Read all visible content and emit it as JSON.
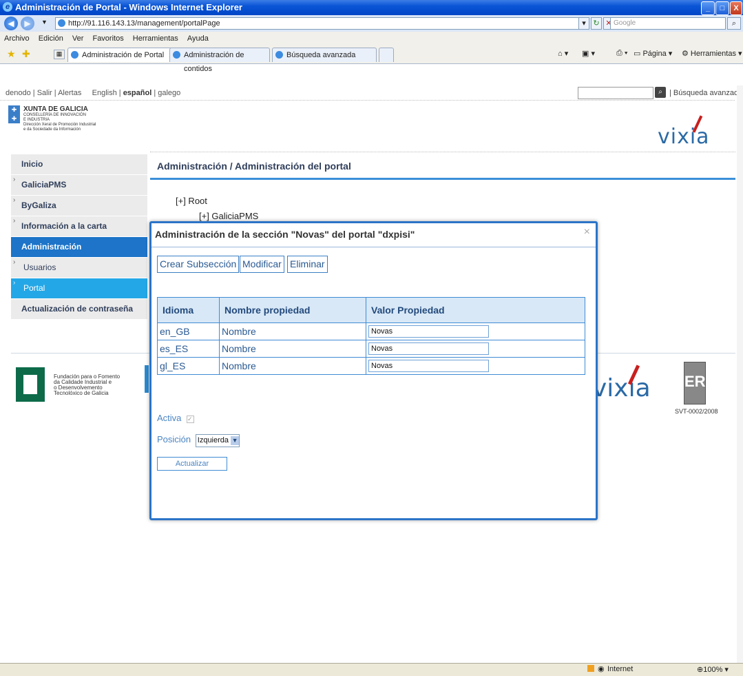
{
  "window": {
    "title": "Administración de Portal - Windows Internet Explorer",
    "controls": [
      "_",
      "□",
      "X"
    ]
  },
  "address": {
    "url": "http://91.116.143.13/management/portalPage",
    "search_placeholder": "Google"
  },
  "menu": [
    "Archivo",
    "Edición",
    "Ver",
    "Favoritos",
    "Herramientas",
    "Ayuda"
  ],
  "tabs": [
    "Administración de Portal",
    "Administración de contidos",
    "Búsqueda avanzada"
  ],
  "toolbar": {
    "page_label": "Página",
    "tools_label": "Herramientas"
  },
  "topbar": {
    "user": "denodo",
    "logout": "Salir",
    "alerts": "Alertas",
    "lang_en": "English",
    "lang_es": "español",
    "lang_gl": "galego",
    "advanced_search": "Búsqueda avanzada"
  },
  "header_logo": {
    "xunta": "XUNTA DE GALICIA",
    "line1": "CONSELLERÍA DE INNOVACIÓN",
    "line2": "E INDUSTRIA",
    "line3": "Dirección Xeral de Promoción Industrial",
    "line4": "e da Sociedade da Información",
    "brand": "vixia"
  },
  "sidebar": {
    "items": [
      {
        "label": "Inicio"
      },
      {
        "label": "GaliciaPMS"
      },
      {
        "label": "ByGaliza"
      },
      {
        "label": "Información a la carta"
      },
      {
        "label": "Administración"
      },
      {
        "label": "Usuarios"
      },
      {
        "label": "Portal"
      },
      {
        "label": "Actualización de contraseña"
      }
    ]
  },
  "main": {
    "title": "Administración / Administración del portal",
    "tree_root": "[+] Root",
    "tree_child": "[+] GaliciaPMS"
  },
  "footer": {
    "fund_line1": "Fundación para o Fomento",
    "fund_line2": "da Calidade Industrial e",
    "fund_line3": "o Desenvolvemento",
    "fund_line4": "Tecnolóxico de Galicia",
    "brand": "vixia",
    "er_letter": "ER",
    "cert": "SVT-0002/2008"
  },
  "modal": {
    "title": "Administración de la sección \"Novas\" del portal \"dxpisi\"",
    "close": "×",
    "buttons": {
      "create": "Crear Subsección",
      "modify": "Modificar",
      "delete": "Eliminar"
    },
    "table": {
      "headers": [
        "Idioma",
        "Nombre propiedad",
        "Valor Propiedad"
      ],
      "rows": [
        {
          "lang": "en_GB",
          "prop": "Nombre",
          "value": "Novas"
        },
        {
          "lang": "es_ES",
          "prop": "Nombre",
          "value": "Novas"
        },
        {
          "lang": "gl_ES",
          "prop": "Nombre",
          "value": "Novas"
        }
      ]
    },
    "active_label": "Activa",
    "active_checked": true,
    "position_label": "Posición",
    "position_value": "Izquierda",
    "update_button": "Actualizar"
  },
  "statusbar": {
    "zone": "Internet",
    "zoom": "100%"
  },
  "colors": {
    "accent": "#1d74c8",
    "titlebar": "#0a55d6",
    "link": "#2a5a93"
  }
}
